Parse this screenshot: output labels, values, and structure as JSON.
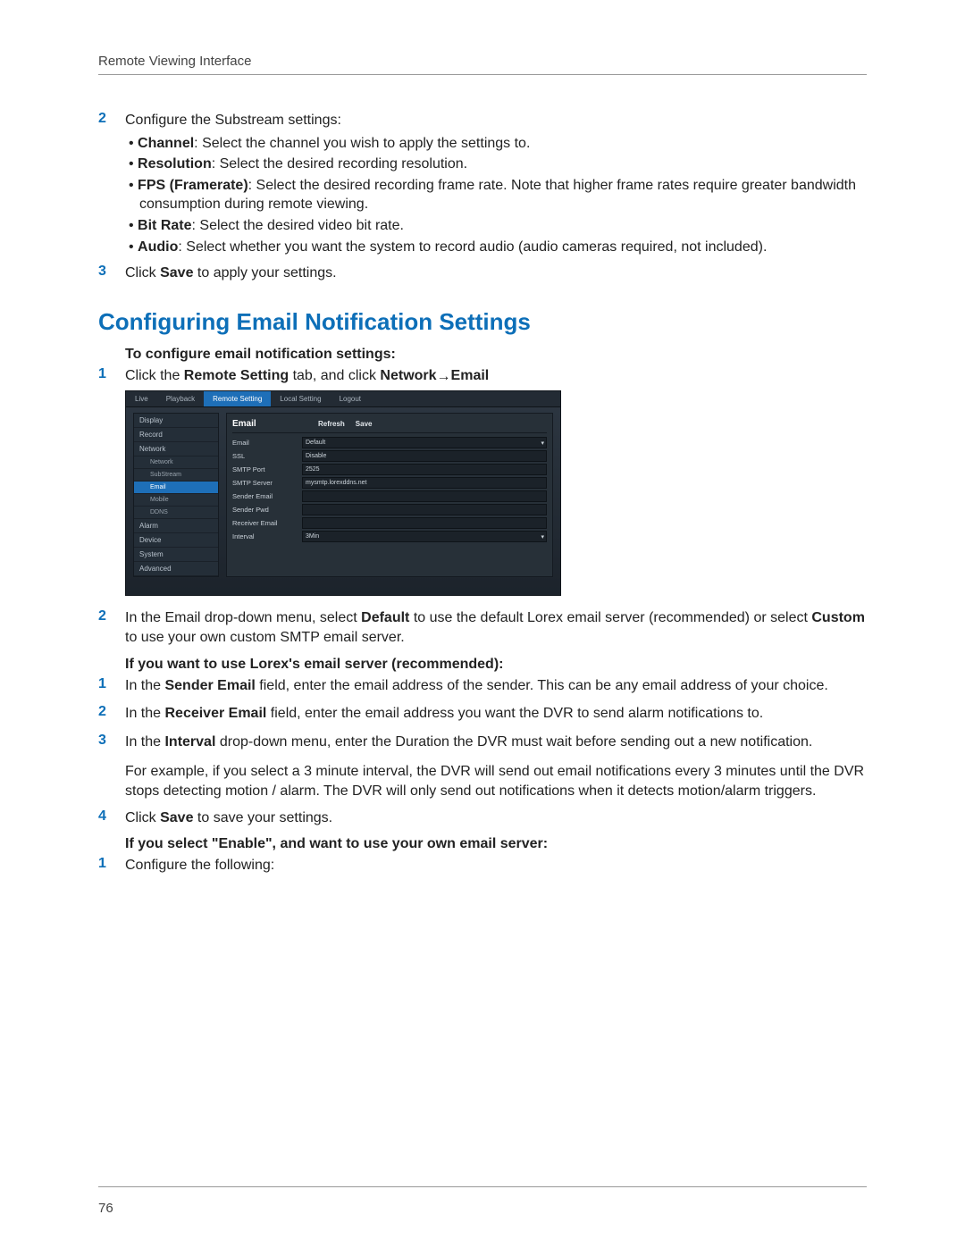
{
  "header": {
    "title": "Remote Viewing Interface"
  },
  "page_number": "76",
  "section_title": "Configuring Email Notification Settings",
  "step2_intro": "Configure the Substream settings:",
  "step2_bullets": {
    "b1": {
      "bold": "Channel",
      "text": ": Select the channel you wish to apply the settings to."
    },
    "b2": {
      "bold": "Resolution",
      "text": ": Select the desired recording resolution."
    },
    "b3": {
      "bold": "FPS (Framerate)",
      "text": ": Select the desired recording frame rate. Note that higher frame rates require greater bandwidth consumption during remote viewing."
    },
    "b4": {
      "bold": "Bit Rate",
      "text": ": Select the desired video bit rate."
    },
    "b5": {
      "bold": "Audio",
      "text": ": Select whether you want the system to record audio (audio cameras required, not included)."
    }
  },
  "step3": {
    "pre": "Click ",
    "bold": "Save",
    "post": " to apply your settings."
  },
  "subA": "To configure email notification settings:",
  "emailStep1": {
    "pre": "Click the ",
    "b1": "Remote Setting",
    "mid": " tab, and click ",
    "b2": "Network",
    "arrow": "→ ",
    "b3": "Email"
  },
  "emailStep2": {
    "pre": "In the Email drop-down menu, select ",
    "b1": "Default",
    "mid1": " to use the default Lorex email server (recommended) or select ",
    "b2": "Custom",
    "post": " to use your own custom SMTP email server."
  },
  "subB": "If you want to use Lorex's email server (recommended):",
  "lorex1": {
    "pre": "In the ",
    "b": "Sender Email",
    "post": " field, enter the email address of the sender. This can be any email address of your choice."
  },
  "lorex2": {
    "pre": "In the ",
    "b": "Receiver Email",
    "post": " field, enter the email address you want the DVR to send alarm notifications to."
  },
  "lorex3": {
    "pre": "In the ",
    "b": "Interval",
    "post": " drop-down menu, enter the Duration the DVR must wait before sending out a new notification."
  },
  "lorex3_example": "For example, if you select a 3 minute interval, the DVR will send out email notifications every 3 minutes until the DVR stops detecting motion / alarm. The DVR will only send out notifications when it detects motion/alarm triggers.",
  "lorex4": {
    "pre": "Click ",
    "b": "Save",
    "post": " to save your settings."
  },
  "subC": "If you select \"Enable\", and want to use your own email server:",
  "own1": "Configure the following:",
  "shot": {
    "tabs": {
      "t1": "Live",
      "t2": "Playback",
      "t3": "Remote Setting",
      "t4": "Local Setting",
      "t5": "Logout"
    },
    "actions": {
      "a1": "",
      "a2": ""
    },
    "side": {
      "display": "Display",
      "record": "Record",
      "network": "Network",
      "sub1": "Network",
      "sub2": "SubStream",
      "sub3": "Email",
      "sub4": "Mobile",
      "sub5": "DDNS",
      "alarm": "Alarm",
      "device": "Device",
      "system": "System",
      "advanced": "Advanced"
    },
    "form": {
      "title": "Email",
      "refresh": "Refresh",
      "save": "Save",
      "rows": {
        "r1": {
          "label": "Email",
          "val": "Default"
        },
        "r2": {
          "label": "SSL",
          "val": "Disable"
        },
        "r3": {
          "label": "SMTP Port",
          "val": "2525"
        },
        "r4": {
          "label": "SMTP Server",
          "val": "mysmtp.lorexddns.net"
        },
        "r5": {
          "label": "Sender Email",
          "val": ""
        },
        "r6": {
          "label": "Sender Pwd",
          "val": ""
        },
        "r7": {
          "label": "Receiver Email",
          "val": ""
        },
        "r8": {
          "label": "Interval",
          "val": "3Min"
        }
      }
    }
  }
}
